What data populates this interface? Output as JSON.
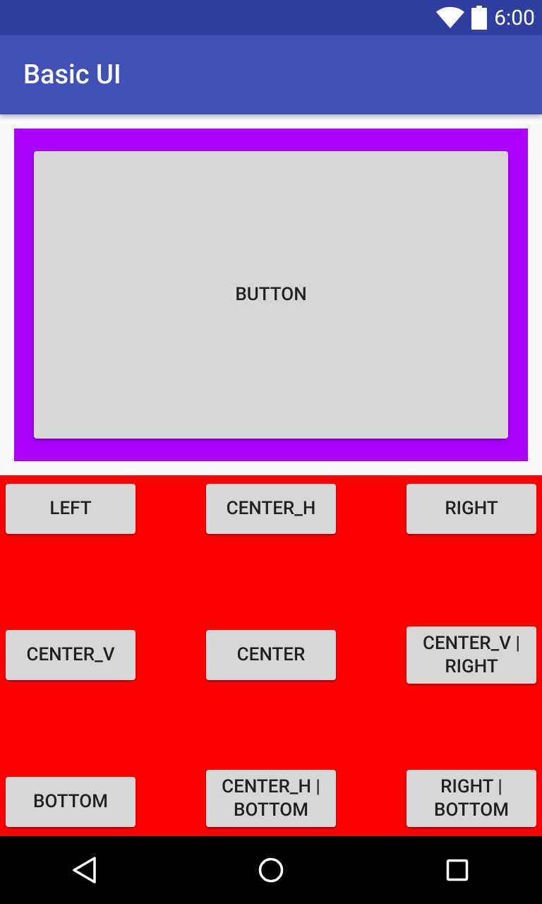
{
  "status_bar": {
    "time": "6:00",
    "icons": [
      "wifi-icon",
      "battery-icon"
    ]
  },
  "app_bar": {
    "title": "Basic UI"
  },
  "main_button": {
    "label": "BUTTON"
  },
  "grid": {
    "left": "LEFT",
    "center_h": "CENTER_H",
    "right": "RIGHT",
    "center_v": "CENTER_V",
    "center": "CENTER",
    "center_v_right": "CENTER_V |\nRIGHT",
    "bottom": "BOTTOM",
    "center_h_bottom": "CENTER_H |\nBOTTOM",
    "right_bottom": "RIGHT |\nBOTTOM"
  },
  "nav_bar": {
    "icons": [
      "back-icon",
      "home-icon",
      "recents-icon"
    ]
  },
  "colors": {
    "status_bar": "#303f9f",
    "app_bar": "#3f51b5",
    "purple_frame": "#aa00ff",
    "red_area": "#ff0000",
    "button": "#d6d7d7"
  }
}
